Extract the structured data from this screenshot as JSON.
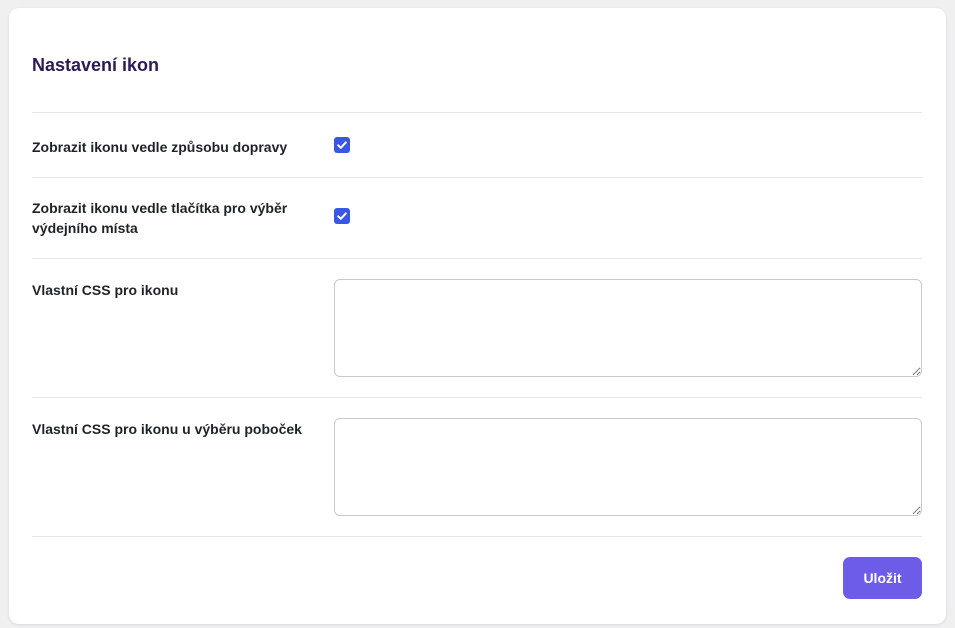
{
  "settings": {
    "title": "Nastavení ikon",
    "rows": [
      {
        "label": "Zobrazit ikonu vedle způsobu dopravy",
        "type": "checkbox",
        "checked": true
      },
      {
        "label": "Zobrazit ikonu vedle tlačítka pro výběr výdejního místa",
        "type": "checkbox",
        "checked": true
      },
      {
        "label": "Vlastní CSS pro ikonu",
        "type": "textarea",
        "value": ""
      },
      {
        "label": "Vlastní CSS pro ikonu u výběru poboček",
        "type": "textarea",
        "value": ""
      }
    ],
    "save_label": "Uložit"
  },
  "colors": {
    "accent": "#6c5ce7",
    "checkbox": "#3a56e4",
    "title": "#2e1a55"
  }
}
